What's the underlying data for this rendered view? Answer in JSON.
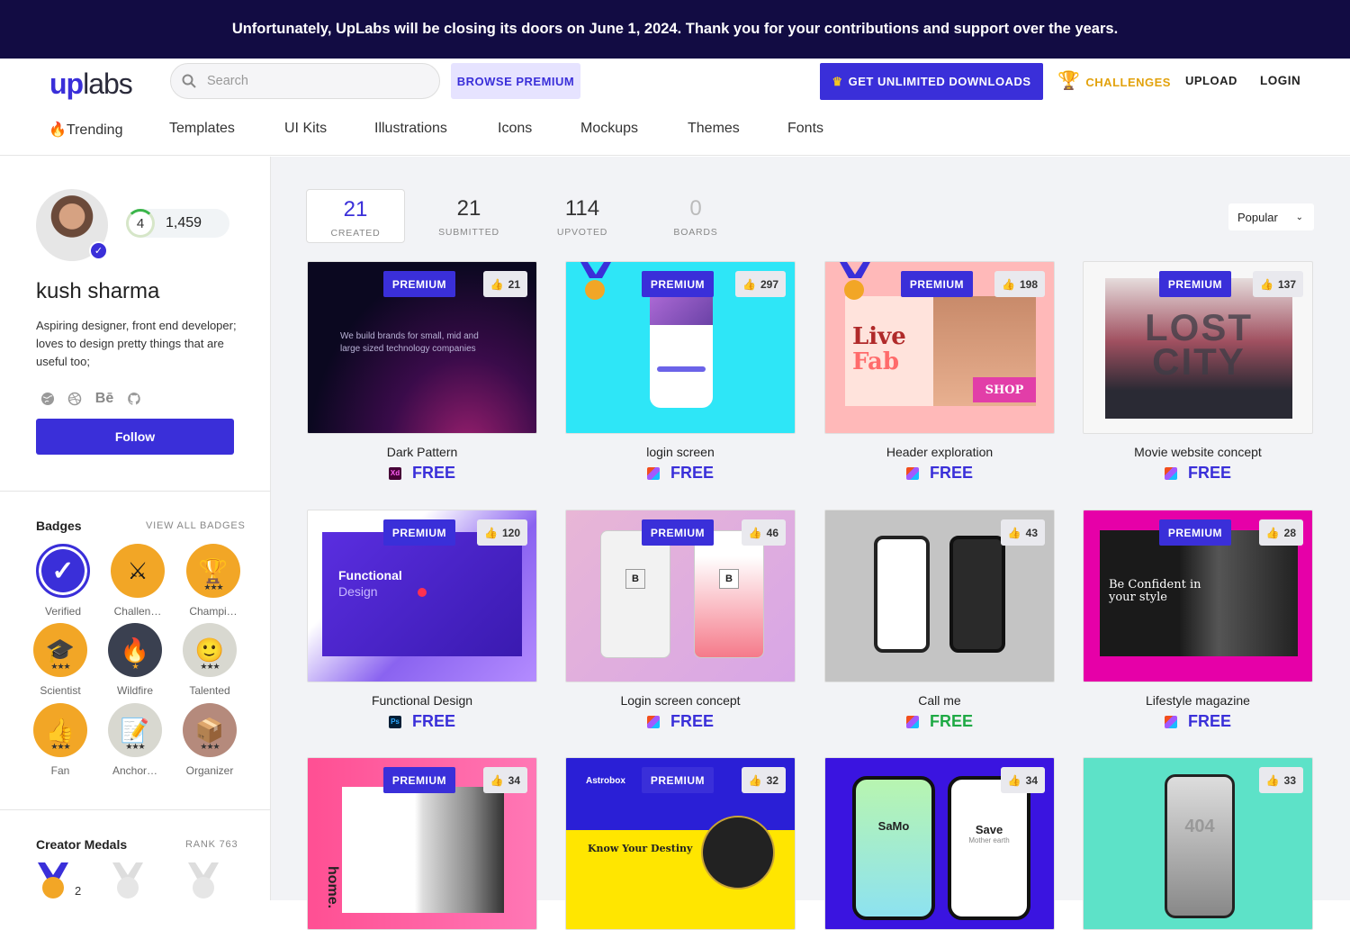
{
  "banner": "Unfortunately, UpLabs will be closing its doors on June 1, 2024. Thank you for your contributions and support over the years.",
  "header": {
    "logo_up": "up",
    "logo_labs": "labs",
    "search_placeholder": "Search",
    "browse_premium": "BROWSE PREMIUM",
    "get_unlimited": "GET UNLIMITED DOWNLOADS",
    "challenges": "CHALLENGES",
    "upload": "UPLOAD",
    "login": "LOGIN",
    "accent_color": "#3a2fd9"
  },
  "categories": [
    "🔥Trending",
    "Templates",
    "UI Kits",
    "Illustrations",
    "Icons",
    "Mockups",
    "Themes",
    "Fonts"
  ],
  "profile": {
    "level": "4",
    "points": "1,459",
    "name": "kush sharma",
    "bio": "Aspiring designer, front end developer; loves to design pretty things that are useful too;",
    "behance": "Bē",
    "follow": "Follow"
  },
  "badges_section": {
    "title": "Badges",
    "view_all": "VIEW ALL BADGES",
    "items": [
      {
        "label": "Verified",
        "icon": "check-icon"
      },
      {
        "label": "Challen…",
        "icon": "swords-icon"
      },
      {
        "label": "Champi…",
        "icon": "trophy-icon"
      },
      {
        "label": "Scientist",
        "icon": "graduation-cap-icon"
      },
      {
        "label": "Wildfire",
        "icon": "fire-icon"
      },
      {
        "label": "Talented",
        "icon": "face-icon"
      },
      {
        "label": "Fan",
        "icon": "thumbs-up-icon"
      },
      {
        "label": "Anchor…",
        "icon": "notepad-icon"
      },
      {
        "label": "Organizer",
        "icon": "box-icon"
      }
    ]
  },
  "medals_section": {
    "title": "Creator Medals",
    "rank": "RANK 763",
    "gold_count": "2"
  },
  "stats": [
    {
      "num": "21",
      "label": "CREATED"
    },
    {
      "num": "21",
      "label": "SUBMITTED"
    },
    {
      "num": "114",
      "label": "UPVOTED"
    },
    {
      "num": "0",
      "label": "BOARDS"
    }
  ],
  "sort": "Popular",
  "cards": [
    {
      "title": "Dark Pattern",
      "likes": "21",
      "premium": "PREMIUM",
      "price": "FREE",
      "tool": "Xd"
    },
    {
      "title": "login screen",
      "likes": "297",
      "premium": "PREMIUM",
      "price": "FREE",
      "tool": "figma"
    },
    {
      "title": "Header exploration",
      "likes": "198",
      "premium": "PREMIUM",
      "price": "FREE",
      "tool": "figma"
    },
    {
      "title": "Movie website concept",
      "likes": "137",
      "premium": "PREMIUM",
      "price": "FREE",
      "tool": "figma"
    },
    {
      "title": "Functional Design",
      "likes": "120",
      "premium": "PREMIUM",
      "price": "FREE",
      "tool": "Ps"
    },
    {
      "title": "Login screen concept",
      "likes": "46",
      "premium": "PREMIUM",
      "price": "FREE",
      "tool": "figma"
    },
    {
      "title": "Call me",
      "likes": "43",
      "premium": "",
      "price": "FREE",
      "tool": "figma"
    },
    {
      "title": "Lifestyle magazine",
      "likes": "28",
      "premium": "PREMIUM",
      "price": "FREE",
      "tool": "figma"
    },
    {
      "title": "",
      "likes": "34",
      "premium": "PREMIUM",
      "price": "",
      "tool": ""
    },
    {
      "title": "",
      "likes": "32",
      "premium": "PREMIUM",
      "price": "",
      "tool": ""
    },
    {
      "title": "",
      "likes": "34",
      "premium": "",
      "price": "",
      "tool": ""
    },
    {
      "title": "",
      "likes": "33",
      "premium": "",
      "price": "",
      "tool": ""
    }
  ],
  "thumb_text": {
    "dark_pattern": "We build brands for small, mid and large sized technology companies",
    "live": "Live",
    "fab": "Fab",
    "shop": "SHOP",
    "lost_city": "LOST CITY",
    "functional": "Functional",
    "design": "Design",
    "be_confident": "Be Confident in your style",
    "login_b": "B",
    "samo": "SaMo",
    "save": "Save",
    "mother_earth": "Mother earth",
    "astrobox": "Astrobox",
    "know_destiny": "Know Your Destiny",
    "home": "home.",
    "err404": "404"
  }
}
